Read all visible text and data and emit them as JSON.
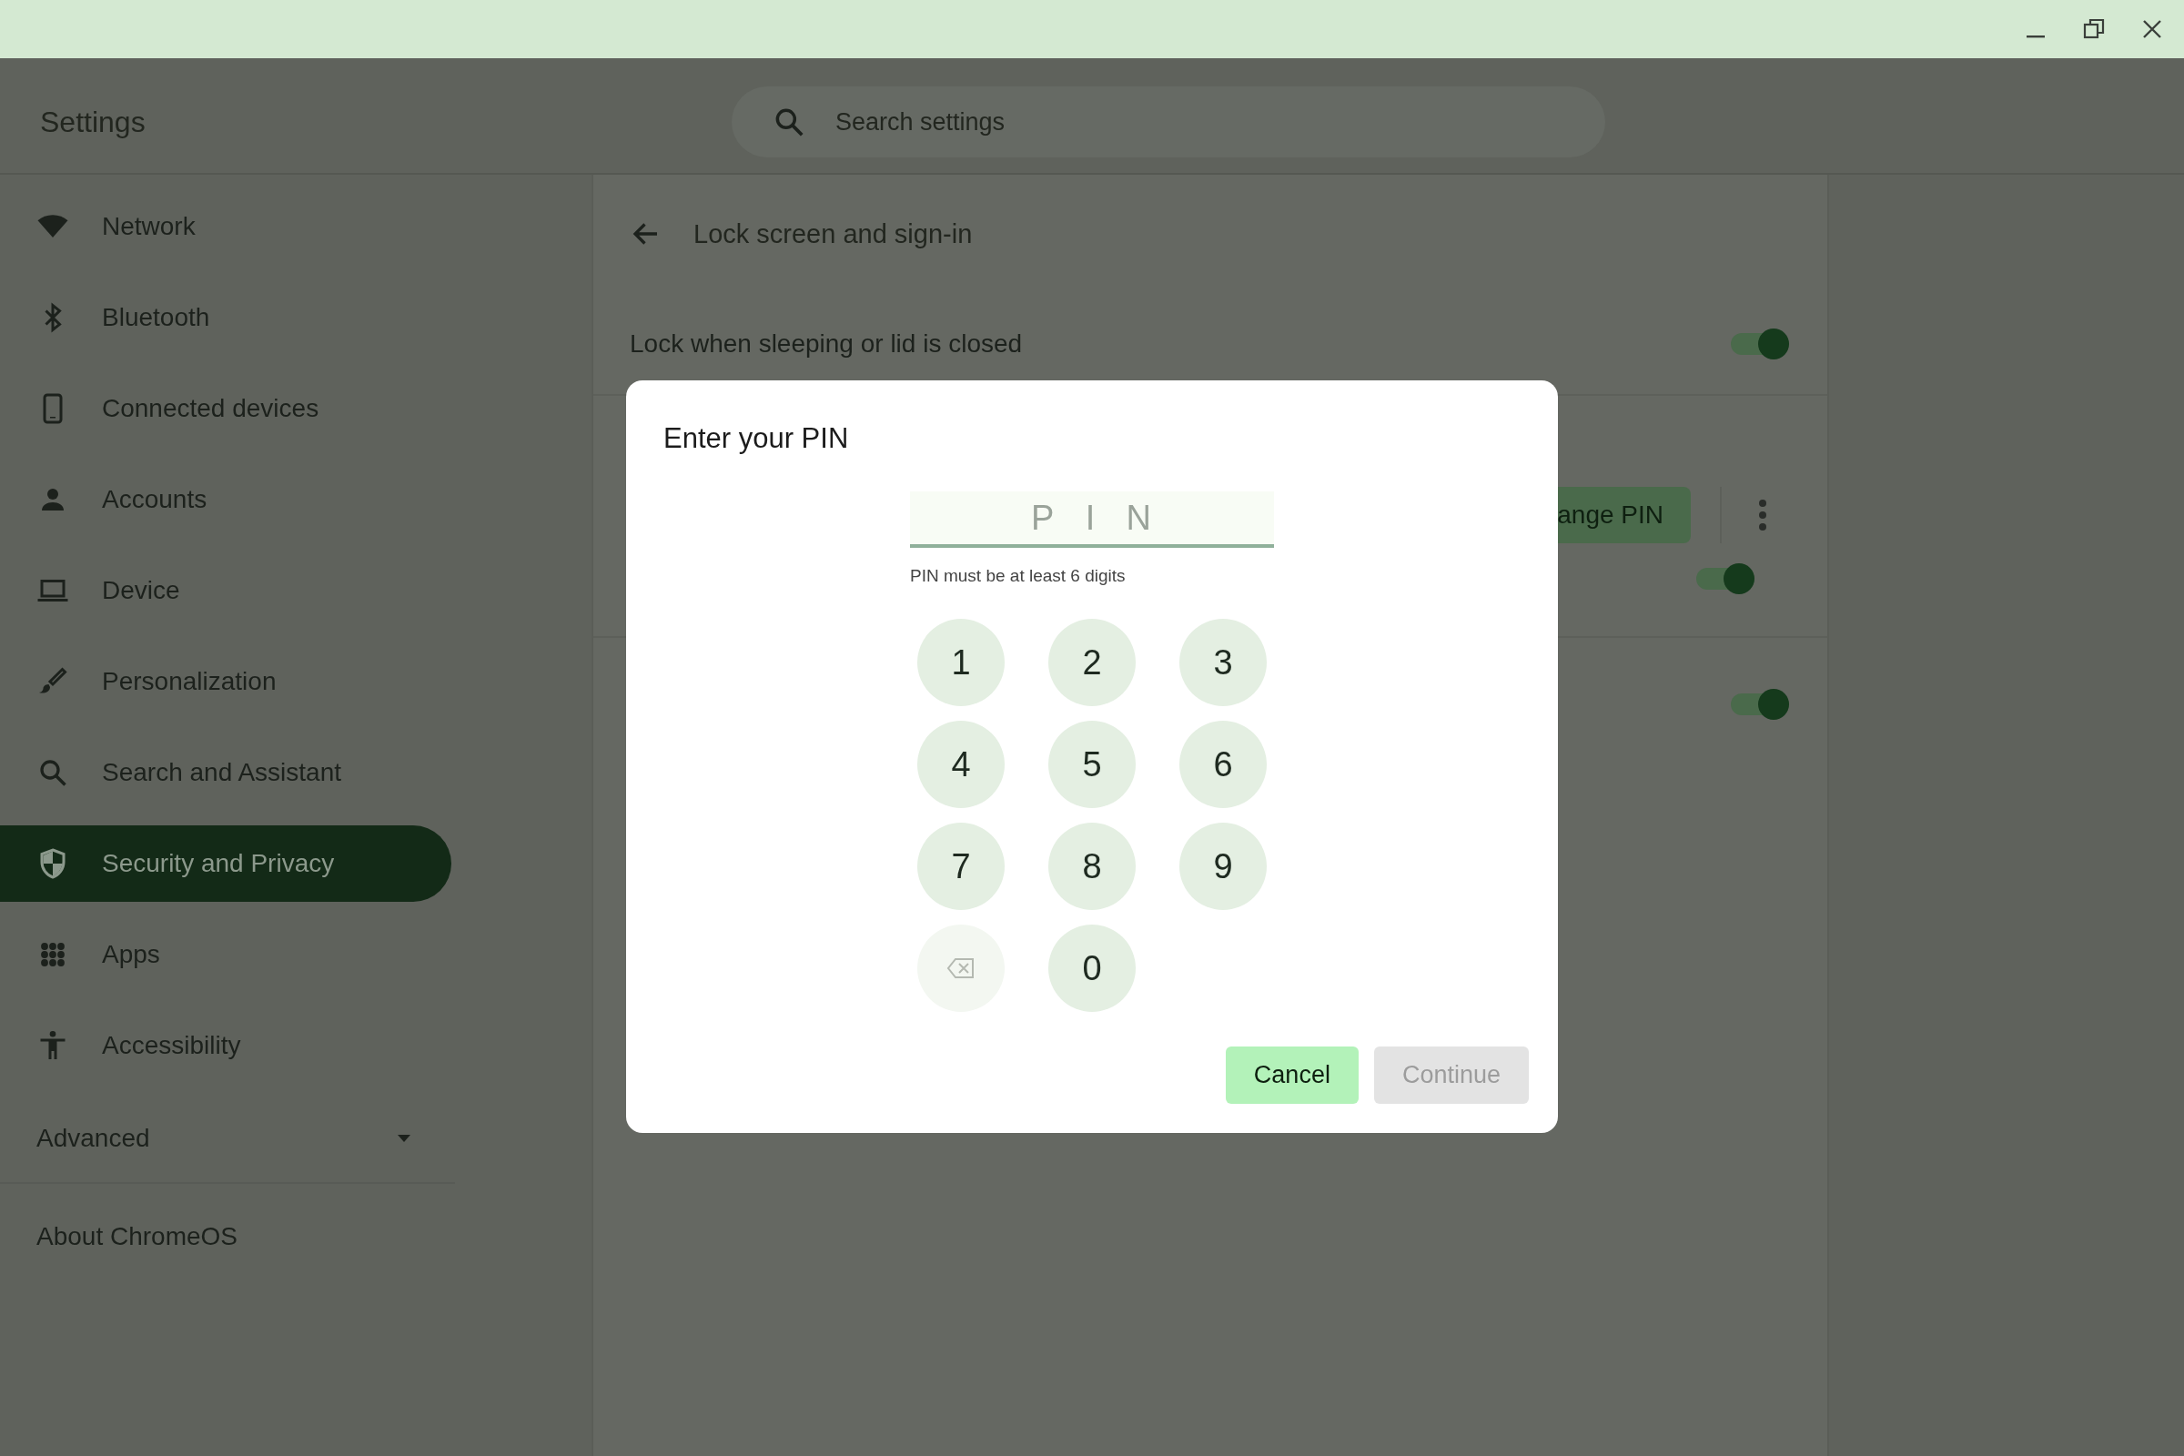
{
  "header": {
    "title": "Settings",
    "search": {
      "placeholder": "Search settings"
    }
  },
  "sidebar": {
    "items": [
      {
        "label": "Network",
        "selected": false
      },
      {
        "label": "Bluetooth",
        "selected": false
      },
      {
        "label": "Connected devices",
        "selected": false
      },
      {
        "label": "Accounts",
        "selected": false
      },
      {
        "label": "Device",
        "selected": false
      },
      {
        "label": "Personalization",
        "selected": false
      },
      {
        "label": "Search and Assistant",
        "selected": false
      },
      {
        "label": "Security and Privacy",
        "selected": true
      },
      {
        "label": "Apps",
        "selected": false
      },
      {
        "label": "Accessibility",
        "selected": false
      }
    ],
    "advanced": {
      "label": "Advanced",
      "expanded": false
    },
    "about": "About ChromeOS"
  },
  "page": {
    "title": "Lock screen and sign-in",
    "rows": [
      {
        "kind": "toggle",
        "label": "Lock when sleeping or lid is closed",
        "on": true
      },
      {
        "kind": "pin",
        "button": "ange PIN",
        "on": true
      },
      {
        "kind": "toggle",
        "on": true
      }
    ]
  },
  "dialog": {
    "title": "Enter your PIN",
    "field": {
      "placeholder": "PIN"
    },
    "hint": "PIN must be at least 6 digits",
    "keys": [
      {
        "kind": "digit",
        "label": "1",
        "disabled": false
      },
      {
        "kind": "digit",
        "label": "2",
        "disabled": false
      },
      {
        "kind": "digit",
        "label": "3",
        "disabled": false
      },
      {
        "kind": "digit",
        "label": "4",
        "disabled": false
      },
      {
        "kind": "digit",
        "label": "5",
        "disabled": false
      },
      {
        "kind": "digit",
        "label": "6",
        "disabled": false
      },
      {
        "kind": "digit",
        "label": "7",
        "disabled": false
      },
      {
        "kind": "digit",
        "label": "8",
        "disabled": false
      },
      {
        "kind": "digit",
        "label": "9",
        "disabled": false
      },
      {
        "kind": "backspace",
        "disabled": true
      },
      {
        "kind": "digit",
        "label": "0",
        "disabled": false
      }
    ],
    "buttons": [
      {
        "label": "Cancel",
        "disabled": false
      },
      {
        "label": "Continue",
        "disabled": true
      }
    ]
  }
}
